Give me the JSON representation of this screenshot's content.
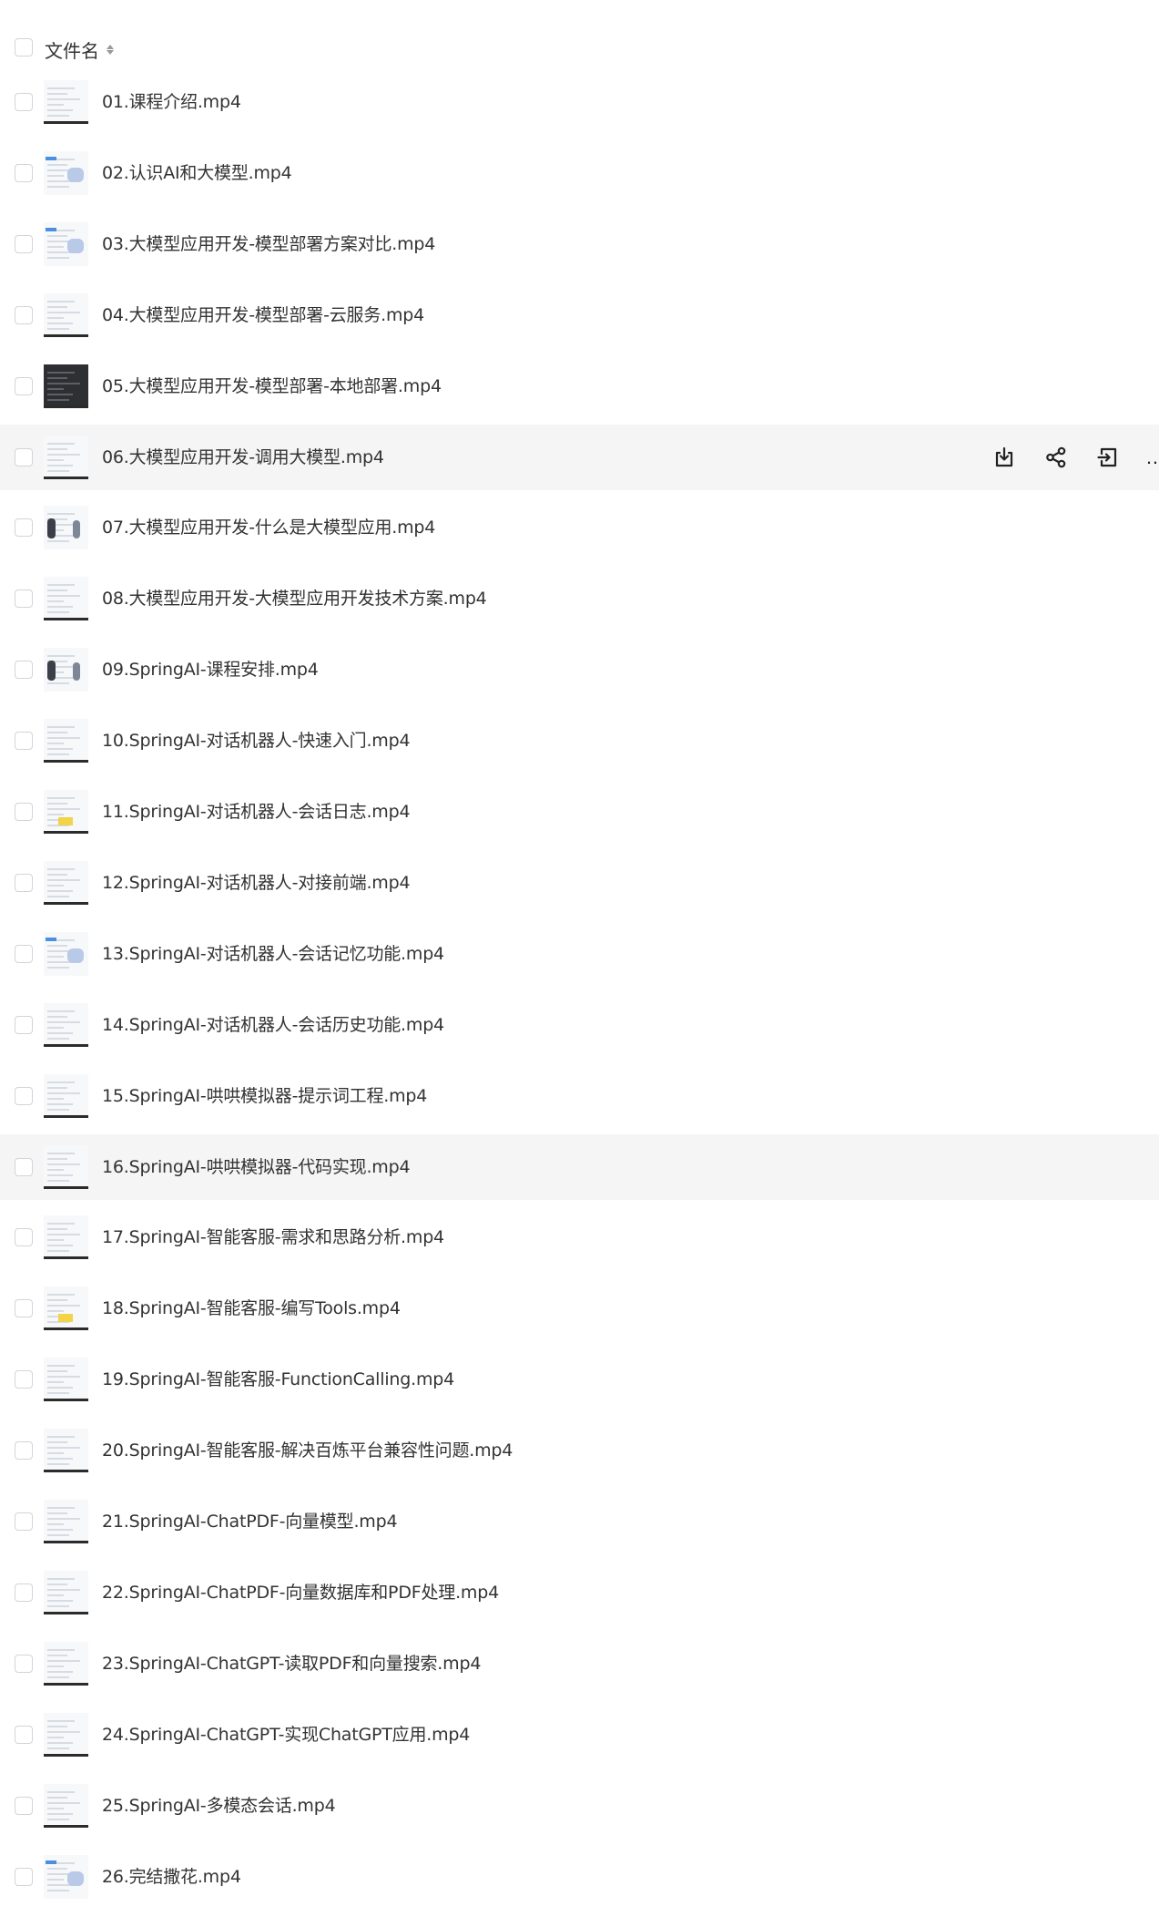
{
  "header": {
    "column_label": "文件名"
  },
  "files": [
    {
      "name": "01.课程介绍.mp4",
      "thumb": "plain"
    },
    {
      "name": "02.认识AI和大模型.mp4",
      "thumb": "blue"
    },
    {
      "name": "03.大模型应用开发-模型部署方案对比.mp4",
      "thumb": "blue"
    },
    {
      "name": "04.大模型应用开发-模型部署-云服务.mp4",
      "thumb": "plain"
    },
    {
      "name": "05.大模型应用开发-模型部署-本地部署.mp4",
      "thumb": "dark"
    },
    {
      "name": "06.大模型应用开发-调用大模型.mp4",
      "thumb": "plain"
    },
    {
      "name": "07.大模型应用开发-什么是大模型应用.mp4",
      "thumb": "people"
    },
    {
      "name": "08.大模型应用开发-大模型应用开发技术方案.mp4",
      "thumb": "plain"
    },
    {
      "name": "09.SpringAI-课程安排.mp4",
      "thumb": "people"
    },
    {
      "name": "10.SpringAI-对话机器人-快速入门.mp4",
      "thumb": "plain"
    },
    {
      "name": "11.SpringAI-对话机器人-会话日志.mp4",
      "thumb": "yellow"
    },
    {
      "name": "12.SpringAI-对话机器人-对接前端.mp4",
      "thumb": "plain"
    },
    {
      "name": "13.SpringAI-对话机器人-会话记忆功能.mp4",
      "thumb": "blue"
    },
    {
      "name": "14.SpringAI-对话机器人-会话历史功能.mp4",
      "thumb": "plain"
    },
    {
      "name": "15.SpringAI-哄哄模拟器-提示词工程.mp4",
      "thumb": "plain"
    },
    {
      "name": "16.SpringAI-哄哄模拟器-代码实现.mp4",
      "thumb": "plain"
    },
    {
      "name": "17.SpringAI-智能客服-需求和思路分析.mp4",
      "thumb": "plain"
    },
    {
      "name": "18.SpringAI-智能客服-编写Tools.mp4",
      "thumb": "yellow"
    },
    {
      "name": "19.SpringAI-智能客服-FunctionCalling.mp4",
      "thumb": "plain"
    },
    {
      "name": "20.SpringAI-智能客服-解决百炼平台兼容性问题.mp4",
      "thumb": "plain"
    },
    {
      "name": "21.SpringAI-ChatPDF-向量模型.mp4",
      "thumb": "plain"
    },
    {
      "name": "22.SpringAI-ChatPDF-向量数据库和PDF处理.mp4",
      "thumb": "plain"
    },
    {
      "name": "23.SpringAI-ChatGPT-读取PDF和向量搜索.mp4",
      "thumb": "plain"
    },
    {
      "name": "24.SpringAI-ChatGPT-实现ChatGPT应用.mp4",
      "thumb": "plain"
    },
    {
      "name": "25.SpringAI-多模态会话.mp4",
      "thumb": "plain"
    },
    {
      "name": "26.完结撒花.mp4",
      "thumb": "blue"
    }
  ],
  "hover_row_index": 5,
  "highlight_row_indices": [
    5,
    15
  ],
  "row_actions": [
    {
      "name": "download-icon"
    },
    {
      "name": "share-icon"
    },
    {
      "name": "move-to-icon"
    },
    {
      "name": "more-icon",
      "label": "…"
    }
  ],
  "colors": {
    "row_highlight": "#f5f5f6",
    "text": "#333333",
    "checkbox_border": "#d4d4d8"
  }
}
